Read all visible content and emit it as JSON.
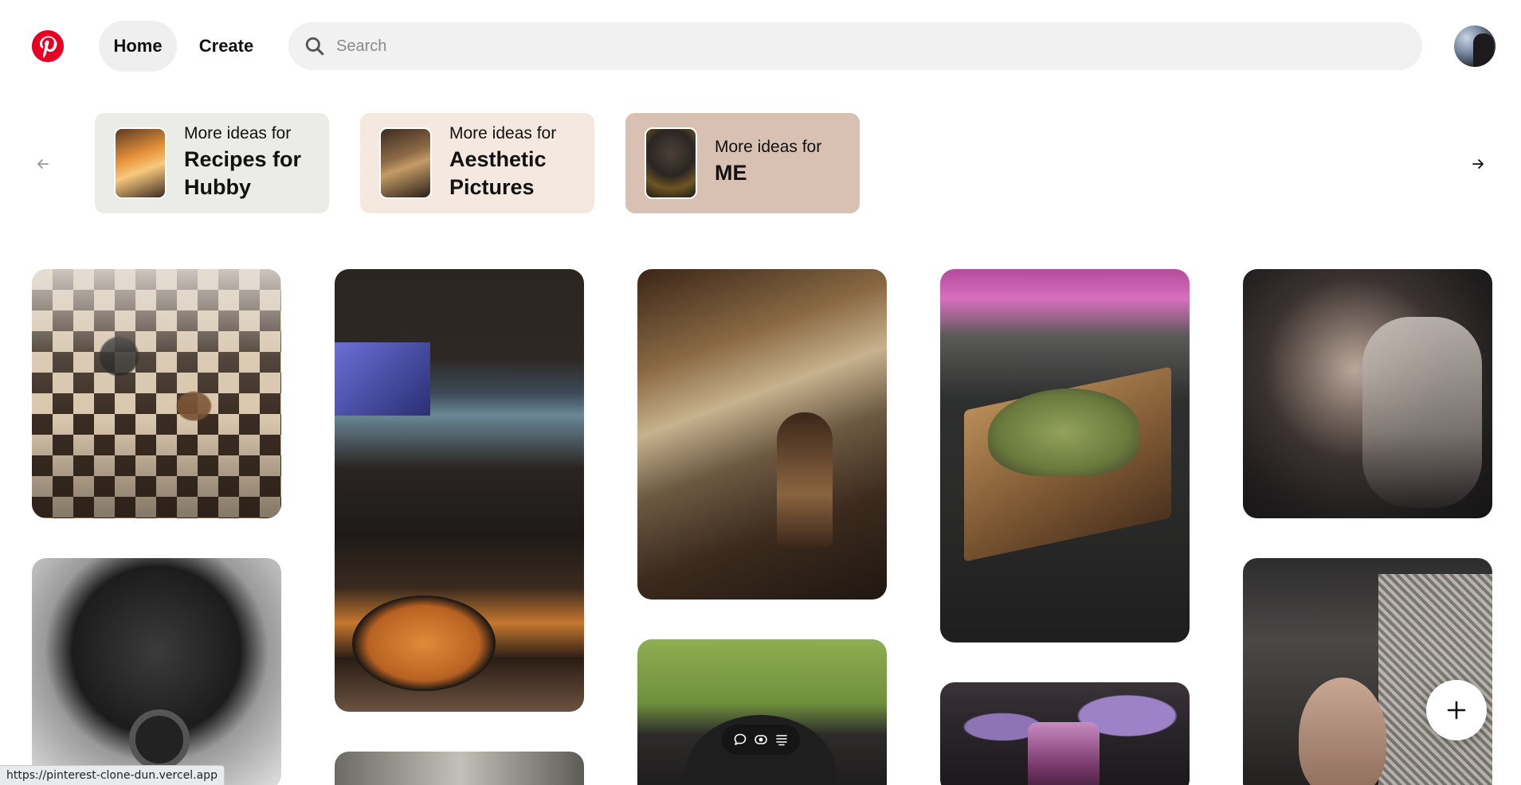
{
  "header": {
    "logo_icon": "pinterest-logo-icon",
    "nav": [
      {
        "label": "Home",
        "active": true
      },
      {
        "label": "Create",
        "active": false
      }
    ],
    "search": {
      "placeholder": "Search",
      "value": "",
      "icon": "search-icon"
    },
    "avatar_icon": "user-avatar"
  },
  "ideas": {
    "prev_icon": "arrow-left-icon",
    "next_icon": "arrow-right-icon",
    "cards": [
      {
        "prefix": "More ideas for",
        "title": "Recipes for Hubby",
        "bg": "#ebebe8"
      },
      {
        "prefix": "More ideas for",
        "title": "Aesthetic Pictures",
        "bg": "#f5e9df"
      },
      {
        "prefix": "More ideas for",
        "title": "ME",
        "bg": "#d8c0b2"
      }
    ]
  },
  "pins": [
    {
      "subject": "chess-board"
    },
    {
      "subject": "pasta-dinner-with-wine"
    },
    {
      "subject": "woman-in-rainy-cafe-painting"
    },
    {
      "subject": "matcha-cake-on-board"
    },
    {
      "subject": "fantasy-couple-portrait"
    },
    {
      "subject": "person-with-camera-bw"
    },
    {
      "subject": "waterfall"
    },
    {
      "subject": "black-dog-on-grass"
    },
    {
      "subject": "lilac-birthday-cake"
    },
    {
      "subject": "queen-with-crown"
    }
  ],
  "pin_toolbar": {
    "icons": [
      "comment-icon",
      "visibility-icon",
      "menu-lines-icon"
    ]
  },
  "fab": {
    "icon": "plus-icon"
  },
  "status_bar": {
    "url": "https://pinterest-clone-dun.vercel.app"
  },
  "colors": {
    "brand": "#e60023",
    "nav_active_bg": "#efefef",
    "search_bg": "#f1f1f1"
  }
}
